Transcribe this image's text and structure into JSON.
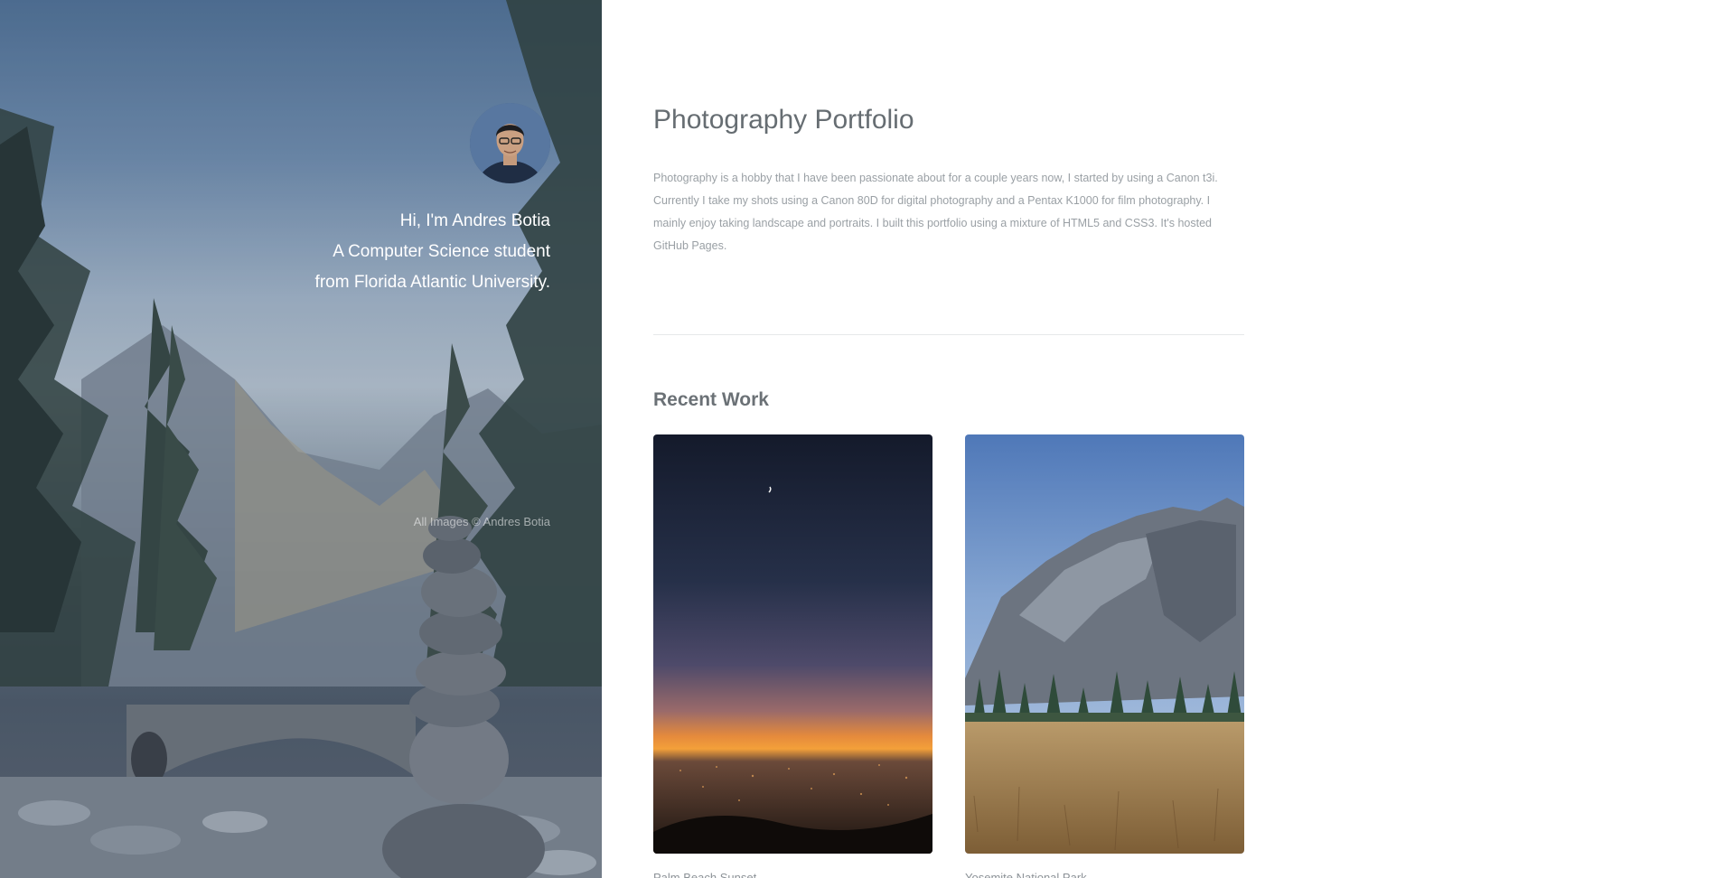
{
  "hero": {
    "greeting": "Hi, I'm Andres Botia",
    "line2": "A Computer Science student",
    "line3": "from Florida Atlantic University.",
    "copyright": "All Images © Andres Botia",
    "avatar_icon": "person-avatar-icon"
  },
  "main": {
    "title": "Photography Portfolio",
    "intro": "Photography is a hobby that I have been passionate about for a couple years now, I started by using a Canon t3i. Currently I take my shots using a Canon 80D for digital photography and a Pentax K1000 for film photography. I mainly enjoy taking landscape and portraits. I built this portfolio using a mixture of HTML5 and CSS3. It's hosted GitHub Pages.",
    "recent_work_title": "Recent Work",
    "works": [
      {
        "caption": "Palm Beach Sunset"
      },
      {
        "caption": "Yosemite National Park"
      }
    ]
  },
  "colors": {
    "title_text": "#666d72",
    "body_text": "#9aa0a5",
    "divider": "#e6e8ea"
  }
}
